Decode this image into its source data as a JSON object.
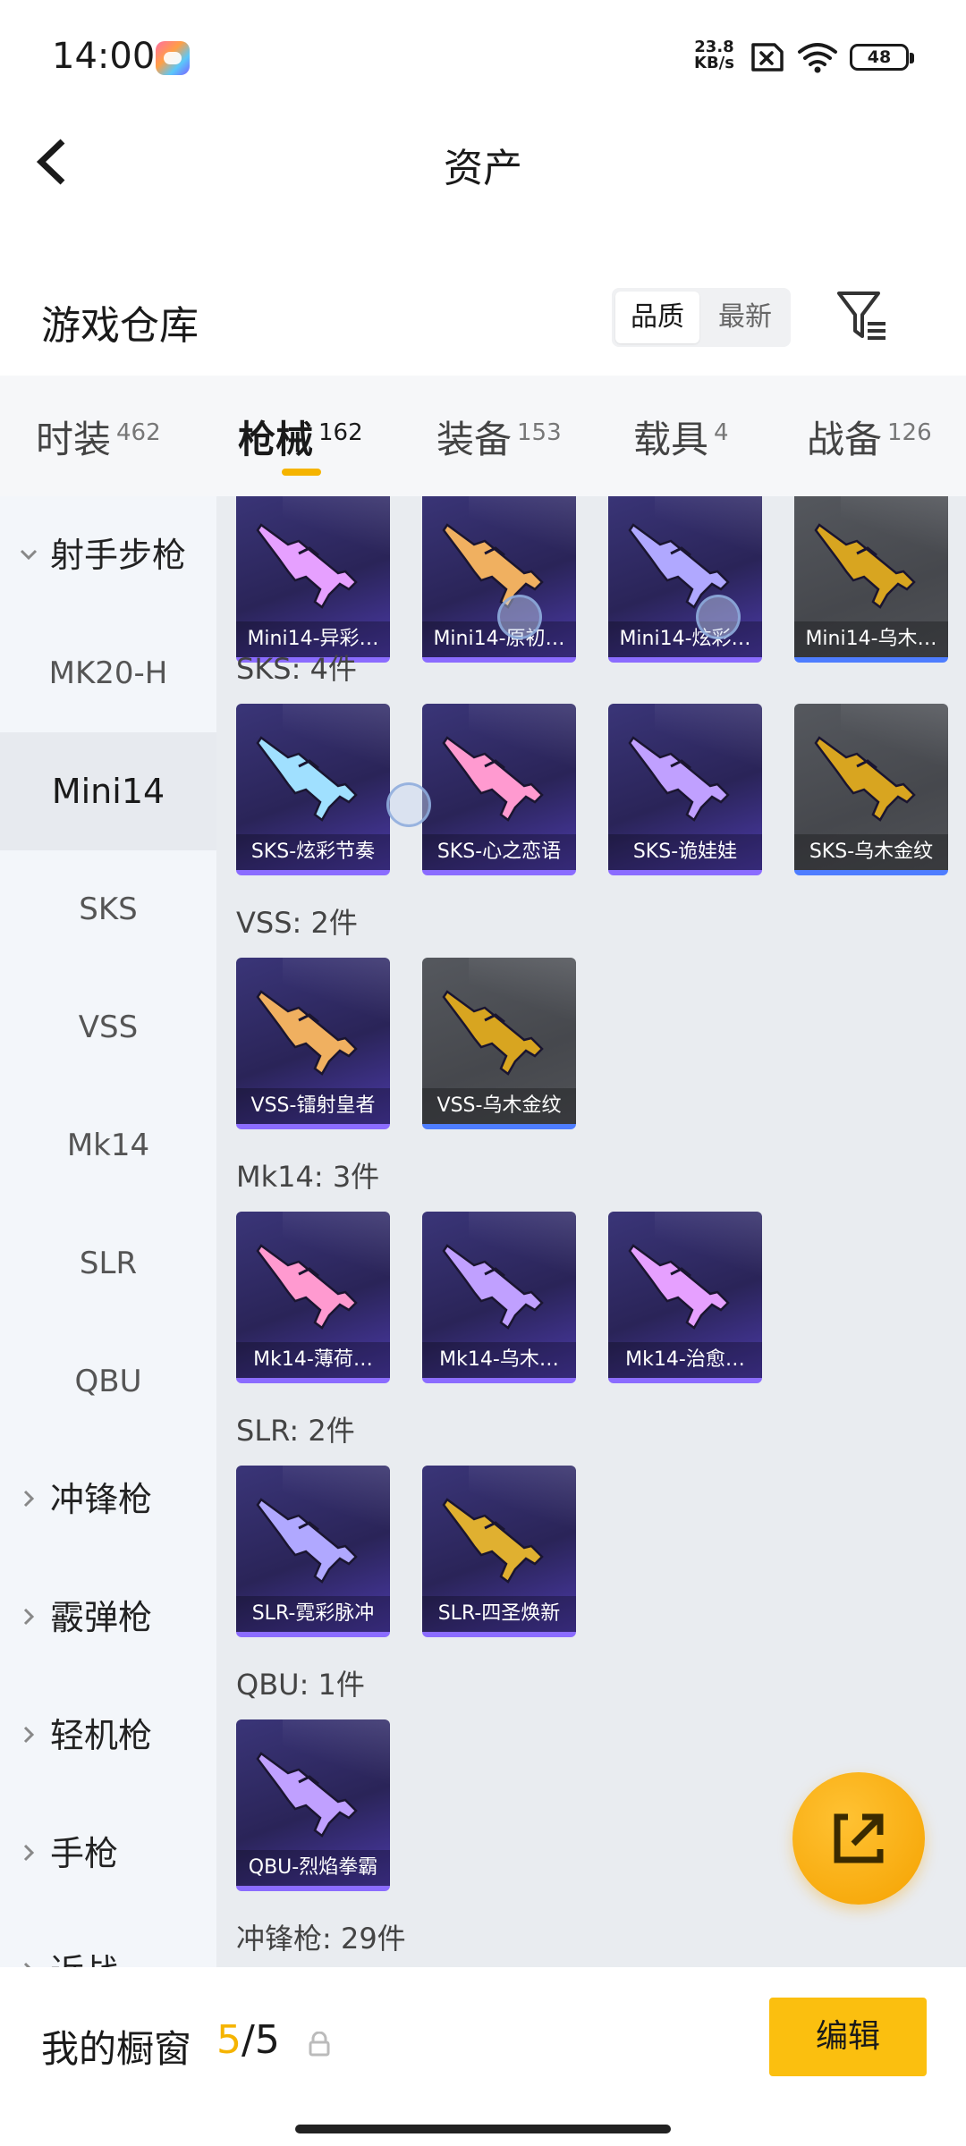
{
  "status_bar": {
    "time": "14:00",
    "net_speed_value": "23.8",
    "net_speed_unit": "KB/s",
    "battery": "48"
  },
  "header": {
    "title": "资产"
  },
  "warehouse": {
    "title": "游戏仓库",
    "sort_quality": "品质",
    "sort_newest": "最新"
  },
  "tabs": [
    {
      "label": "时装",
      "count": "462"
    },
    {
      "label": "枪械",
      "count": "162"
    },
    {
      "label": "装备",
      "count": "153"
    },
    {
      "label": "载具",
      "count": "4"
    },
    {
      "label": "战备",
      "count": "126"
    }
  ],
  "sidebar": {
    "groups": [
      "射手步枪",
      "冲锋枪",
      "霰弹枪",
      "轻机枪",
      "手枪",
      "近战"
    ],
    "subitems": [
      "MK20-H",
      "Mini14",
      "SKS",
      "VSS",
      "Mk14",
      "SLR",
      "QBU"
    ]
  },
  "sections": [
    {
      "title": "",
      "items": [
        {
          "name": "Mini14-异彩…",
          "rarity": "purple"
        },
        {
          "name": "Mini14-原初…",
          "rarity": "purple"
        },
        {
          "name": "Mini14-炫彩…",
          "rarity": "purple"
        },
        {
          "name": "Mini14-乌木…",
          "rarity": "gray"
        }
      ]
    },
    {
      "title": "SKS: 4件",
      "items": [
        {
          "name": "SKS-炫彩节奏",
          "rarity": "purple"
        },
        {
          "name": "SKS-心之恋语",
          "rarity": "purple"
        },
        {
          "name": "SKS-诡娃娃",
          "rarity": "purple"
        },
        {
          "name": "SKS-乌木金纹",
          "rarity": "gray"
        }
      ]
    },
    {
      "title": "VSS: 2件",
      "items": [
        {
          "name": "VSS-镭射皇者",
          "rarity": "purple"
        },
        {
          "name": "VSS-乌木金纹",
          "rarity": "gray"
        }
      ]
    },
    {
      "title": "Mk14: 3件",
      "items": [
        {
          "name": "Mk14-薄荷…",
          "rarity": "purple"
        },
        {
          "name": "Mk14-乌木…",
          "rarity": "purple"
        },
        {
          "name": "Mk14-治愈…",
          "rarity": "purple"
        }
      ]
    },
    {
      "title": "SLR: 2件",
      "items": [
        {
          "name": "SLR-霓彩脉冲",
          "rarity": "purple"
        },
        {
          "name": "SLR-四圣焕新",
          "rarity": "purple"
        }
      ]
    },
    {
      "title": "QBU: 1件",
      "items": [
        {
          "name": "QBU-烈焰拳霸",
          "rarity": "purple"
        }
      ]
    },
    {
      "title": "冲锋枪: 29件",
      "items": []
    }
  ],
  "bottom": {
    "showcase_label": "我的橱窗",
    "showcase_current": "5",
    "showcase_total": "/5",
    "edit_label": "编辑"
  },
  "colors": {
    "accent": "#f5b400",
    "purple_card": "#2f2a66",
    "gray_card": "#4b4d52"
  }
}
